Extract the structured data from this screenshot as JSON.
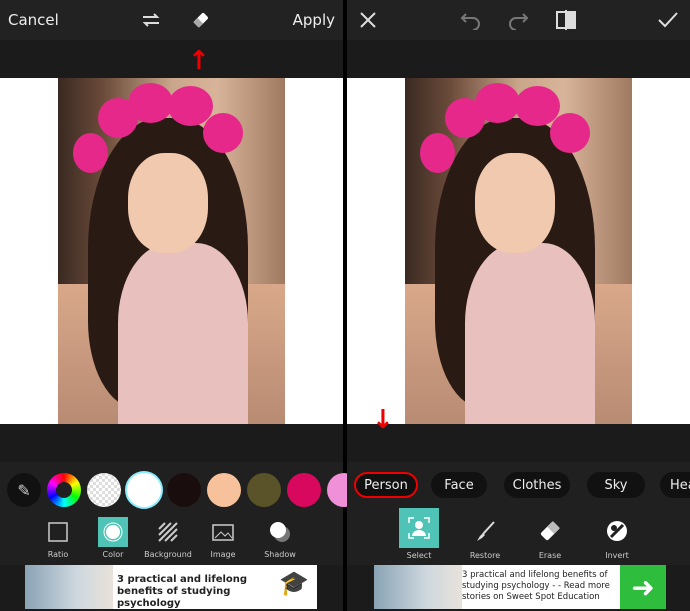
{
  "left": {
    "cancel_label": "Cancel",
    "apply_label": "Apply",
    "icons": [
      "swap-icon",
      "eraser-icon"
    ],
    "swatches": [
      "#eeeeee",
      "#ffffff",
      "#1a0d0d",
      "#f7c29b",
      "#5a5228",
      "#d8085e",
      "#f090d8"
    ],
    "tools": [
      {
        "label": "Ratio",
        "icon": "ratio-icon"
      },
      {
        "label": "Color",
        "icon": "color-icon",
        "active": true
      },
      {
        "label": "Background",
        "icon": "background-icon"
      },
      {
        "label": "Image",
        "icon": "image-icon"
      },
      {
        "label": "Shadow",
        "icon": "shadow-icon"
      }
    ],
    "ad_text": "3 practical and lifelong benefits of studying psychology"
  },
  "right": {
    "icons": [
      "close-icon",
      "undo-icon",
      "redo-icon",
      "compare-icon",
      "check-icon"
    ],
    "chips": [
      "Person",
      "Face",
      "Clothes",
      "Sky",
      "Hea"
    ],
    "tools": [
      {
        "label": "Select",
        "icon": "select-person-icon",
        "active": true
      },
      {
        "label": "Restore",
        "icon": "brush-icon"
      },
      {
        "label": "Erase",
        "icon": "eraser-icon"
      },
      {
        "label": "Invert",
        "icon": "invert-icon"
      }
    ],
    "ad_text": "3 practical and lifelong benefits of studying psychology - - Read more stories on Sweet Spot Education"
  },
  "colors": {
    "accent": "#4fc3b5",
    "annotation": "#e00000",
    "ad_green": "#2ebd3c"
  }
}
